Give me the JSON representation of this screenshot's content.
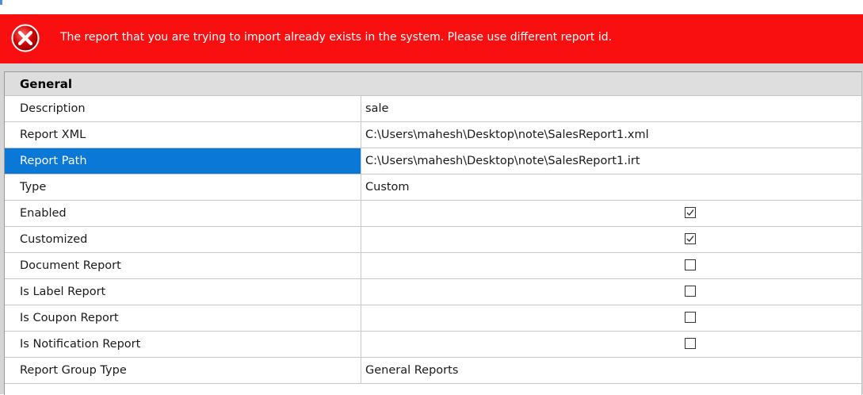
{
  "error": {
    "message": "The report that you are trying to import already exists in the system. Please use different report id."
  },
  "section": {
    "title": "General"
  },
  "rows": [
    {
      "label": "Description",
      "value": "sale"
    },
    {
      "label": "Report XML",
      "value": "C:\\Users\\mahesh\\Desktop\\note\\SalesReport1.xml"
    },
    {
      "label": "Report Path",
      "value": "C:\\Users\\mahesh\\Desktop\\note\\SalesReport1.irt"
    },
    {
      "label": "Type",
      "value": "Custom"
    },
    {
      "label": "Enabled",
      "checked": true
    },
    {
      "label": "Customized",
      "checked": true
    },
    {
      "label": "Document Report",
      "checked": false
    },
    {
      "label": "Is Label Report",
      "checked": false
    },
    {
      "label": "Is Coupon Report",
      "checked": false
    },
    {
      "label": "Is Notification Report",
      "checked": false
    },
    {
      "label": "Report Group Type",
      "value": "General Reports"
    }
  ],
  "selected_row": "Report Path",
  "colors": {
    "error_banner": "#f90f0f",
    "selection": "#0a78d7"
  },
  "icons": {
    "error": "error-x-icon",
    "checked": "checkmark-icon"
  }
}
